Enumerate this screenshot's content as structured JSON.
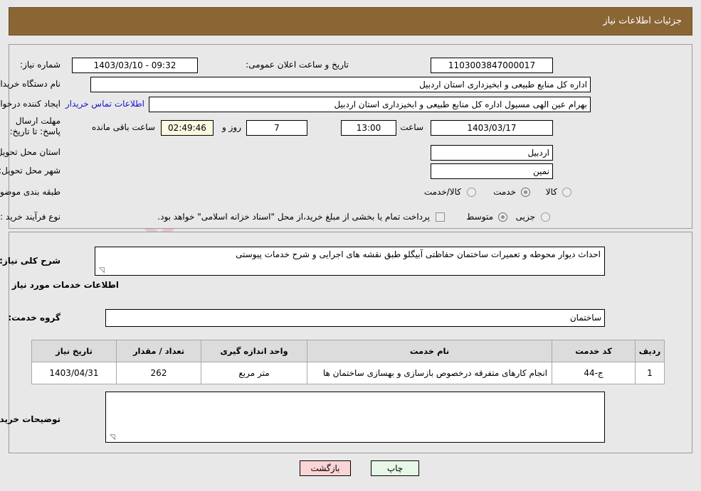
{
  "window": {
    "title": "جزئیات اطلاعات نیاز",
    "title_bg": "#8a6635"
  },
  "watermark": {
    "text": "AriaTender.net"
  },
  "top_panel": {
    "need_number_label": "شماره نیاز:",
    "need_number_value": "1103003847000017",
    "announce_label": "تاریخ و ساعت اعلان عمومی:",
    "announce_value": "1403/03/10 - 09:32",
    "buyer_org_label": "نام دستگاه خریدار:",
    "buyer_org_value": "اداره کل منابع طبیعی و ابخیزداری استان اردبیل",
    "requester_label": "ایجاد کننده درخواست:",
    "requester_value": "بهرام عین الهی مسیول اداره کل منابع طبیعی و ابخیزداری استان اردبیل",
    "contact_link": "اطلاعات تماس خریدار",
    "deadline_label": "مهلت ارسال پاسخ: تا تاریخ:",
    "deadline_date": "1403/03/17",
    "deadline_time_label": "ساعت",
    "deadline_time_value": "13:00",
    "remaining_days_value": "7",
    "remaining_days_label": "روز و",
    "remaining_clock_value": "02:49:46",
    "remaining_clock_label": "ساعت باقی مانده",
    "province_label": "استان محل تحویل:",
    "province_value": "اردبیل",
    "city_label": "شهر محل تحویل:",
    "city_value": "نمین",
    "category_label": "طبقه بندی موضوعی:",
    "category_options": [
      {
        "label": "کالا",
        "selected": false
      },
      {
        "label": "خدمت",
        "selected": true
      },
      {
        "label": "کالا/خدمت",
        "selected": false
      }
    ],
    "process_label": "نوع فرآیند خرید :",
    "process_options": [
      {
        "label": "جزیی",
        "selected": false
      },
      {
        "label": "متوسط",
        "selected": true
      }
    ],
    "treasury_checkbox_label": "پرداخت تمام یا بخشی از مبلغ خرید،از محل \"اسناد خزانه اسلامی\" خواهد بود.",
    "treasury_checked": false
  },
  "bottom_panel": {
    "need_desc_label": "شرح کلی نیاز:",
    "need_desc_value": "احداث دیوار محوطه و تعمیرات ساختمان حفاظتی آبیگلو طبق نقشه های اجرایی و شرح خدمات پیوستی",
    "services_section_title": "اطلاعات خدمات مورد نیاز",
    "service_group_label": "گروه خدمت:",
    "service_group_value": "ساختمان",
    "table": {
      "headers": [
        "ردیف",
        "کد خدمت",
        "نام خدمت",
        "واحد اندازه گیری",
        "تعداد / مقدار",
        "تاریخ نیاز"
      ],
      "rows": [
        {
          "row": "1",
          "code": "ج-44",
          "name": "انجام کارهای متفرقه درخصوص بازسازی و بهسازی ساختمان ها",
          "unit": "متر مربع",
          "qty": "262",
          "date": "1403/04/31"
        }
      ]
    },
    "buyer_notes_label": "توضیحات خریدار;",
    "buyer_notes_value": ""
  },
  "footer": {
    "print_label": "چاپ",
    "back_label": "بازگشت"
  }
}
